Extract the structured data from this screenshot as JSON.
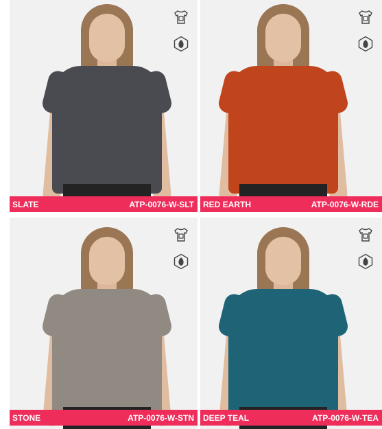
{
  "colors": {
    "accent": "#ee2d5b",
    "background": "#f1f1f1"
  },
  "products": [
    {
      "color_name": "SLATE",
      "sku": "ATP-0076-W-SLT",
      "shirt_color": "#4a4b50"
    },
    {
      "color_name": "RED EARTH",
      "sku": "ATP-0076-W-RDE",
      "shirt_color": "#c1451c"
    },
    {
      "color_name": "STONE",
      "sku": "ATP-0076-W-STN",
      "shirt_color": "#908a83"
    },
    {
      "color_name": "DEEP TEAL",
      "sku": "ATP-0076-W-TEA",
      "shirt_color": "#1f6377"
    }
  ],
  "icons": {
    "badge_1": "tshirt-print-icon",
    "badge_2": "leaf-hexagon-icon"
  }
}
